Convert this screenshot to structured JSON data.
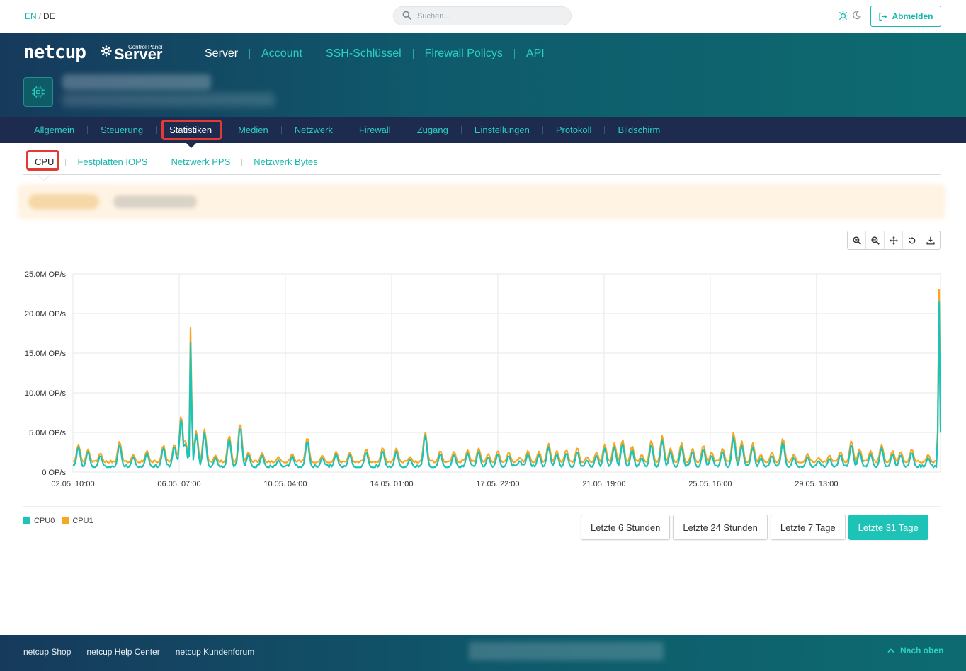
{
  "topbar": {
    "lang_en": "EN",
    "lang_sep": "/",
    "lang_de": "DE",
    "search_placeholder": "Suchen...",
    "logout_label": "Abmelden"
  },
  "header": {
    "brand": "netcup",
    "product": "Server",
    "product_sub": "Control Panel",
    "nav": [
      "Server",
      "Account",
      "SSH-Schlüssel",
      "Firewall Policys",
      "API"
    ]
  },
  "subnav": [
    "Allgemein",
    "Steuerung",
    "Statistiken",
    "Medien",
    "Netzwerk",
    "Firewall",
    "Zugang",
    "Einstellungen",
    "Protokoll",
    "Bildschirm"
  ],
  "tabs": [
    "CPU",
    "Festplatten IOPS",
    "Netzwerk PPS",
    "Netzwerk Bytes"
  ],
  "ranges": [
    "Letzte 6 Stunden",
    "Letzte 24 Stunden",
    "Letzte 7 Tage",
    "Letzte 31 Tage"
  ],
  "footer": {
    "links": [
      "netcup Shop",
      "netcup Help Center",
      "netcup Kundenforum"
    ],
    "to_top": "Nach oben"
  },
  "colors": {
    "accent": "#17b8ad",
    "cpu0": "#1cc3b6",
    "cpu1": "#f5a623",
    "highlight": "#e53935"
  },
  "chart_data": {
    "type": "line",
    "yticks": [
      "25.0M OP/s",
      "20.0M OP/s",
      "15.0M OP/s",
      "10.0M OP/s",
      "5.0M OP/s",
      "0 OP/s"
    ],
    "ylim": [
      0,
      25000000
    ],
    "xticks": [
      "02.05. 10:00",
      "06.05. 07:00",
      "10.05. 04:00",
      "14.05. 01:00",
      "17.05. 22:00",
      "21.05. 19:00",
      "25.05. 16:00",
      "29.05. 13:00"
    ],
    "xlim_days": [
      0,
      31.65
    ],
    "series": [
      {
        "name": "CPU0",
        "color": "#1cc3b6",
        "baseline": 600000,
        "noise": 350000,
        "peaks": [
          [
            0.2,
            3.2
          ],
          [
            0.55,
            2.6
          ],
          [
            1.0,
            2.1
          ],
          [
            1.7,
            3.5
          ],
          [
            2.2,
            1.9
          ],
          [
            2.7,
            2.4
          ],
          [
            3.3,
            3.1
          ],
          [
            3.7,
            3.3
          ],
          [
            3.95,
            6.8
          ],
          [
            4.1,
            3.6
          ],
          [
            4.3,
            17.8
          ],
          [
            4.5,
            4.8
          ],
          [
            4.8,
            5.0
          ],
          [
            5.2,
            1.8
          ],
          [
            5.7,
            4.2
          ],
          [
            6.1,
            5.8
          ],
          [
            6.4,
            2.2
          ],
          [
            6.9,
            2.1
          ],
          [
            7.5,
            1.5
          ],
          [
            8.0,
            2.0
          ],
          [
            8.55,
            4.0
          ],
          [
            9.1,
            1.8
          ],
          [
            9.6,
            2.3
          ],
          [
            10.1,
            2.2
          ],
          [
            10.7,
            2.5
          ],
          [
            11.3,
            2.7
          ],
          [
            11.8,
            2.6
          ],
          [
            12.3,
            1.6
          ],
          [
            12.85,
            4.7
          ],
          [
            13.4,
            2.3
          ],
          [
            13.9,
            2.2
          ],
          [
            14.4,
            2.4
          ],
          [
            14.8,
            2.6
          ],
          [
            15.15,
            1.9
          ],
          [
            15.5,
            2.3
          ],
          [
            15.9,
            2.1
          ],
          [
            16.3,
            1.4
          ],
          [
            16.6,
            2.3
          ],
          [
            17.0,
            2.2
          ],
          [
            17.35,
            3.2
          ],
          [
            17.65,
            2.3
          ],
          [
            18.0,
            2.4
          ],
          [
            18.4,
            2.6
          ],
          [
            18.75,
            1.5
          ],
          [
            19.1,
            2.1
          ],
          [
            19.4,
            3.0
          ],
          [
            19.75,
            3.2
          ],
          [
            20.05,
            3.6
          ],
          [
            20.4,
            2.8
          ],
          [
            20.75,
            1.8
          ],
          [
            21.1,
            3.5
          ],
          [
            21.5,
            4.1
          ],
          [
            21.8,
            2.6
          ],
          [
            22.2,
            3.2
          ],
          [
            22.6,
            2.6
          ],
          [
            23.0,
            2.9
          ],
          [
            23.3,
            2.1
          ],
          [
            23.7,
            2.6
          ],
          [
            24.1,
            4.4
          ],
          [
            24.4,
            3.4
          ],
          [
            24.8,
            3.2
          ],
          [
            25.1,
            1.8
          ],
          [
            25.5,
            2.1
          ],
          [
            25.9,
            3.8
          ],
          [
            26.3,
            1.8
          ],
          [
            26.8,
            1.9
          ],
          [
            27.2,
            1.4
          ],
          [
            27.6,
            1.7
          ],
          [
            28.0,
            2.2
          ],
          [
            28.4,
            3.5
          ],
          [
            28.7,
            2.5
          ],
          [
            29.1,
            2.3
          ],
          [
            29.5,
            3.1
          ],
          [
            29.9,
            2.3
          ],
          [
            30.2,
            2.2
          ],
          [
            30.6,
            2.5
          ],
          [
            31.2,
            1.8
          ],
          [
            31.6,
            21.5
          ]
        ]
      },
      {
        "name": "CPU1",
        "color": "#f5a623",
        "baseline": 1200000,
        "noise": 300000,
        "peaks": [
          [
            0.2,
            3.5
          ],
          [
            0.55,
            2.9
          ],
          [
            1.0,
            2.4
          ],
          [
            1.7,
            3.9
          ],
          [
            2.2,
            2.2
          ],
          [
            2.7,
            2.7
          ],
          [
            3.3,
            3.4
          ],
          [
            3.7,
            3.6
          ],
          [
            3.95,
            7.2
          ],
          [
            4.1,
            4.0
          ],
          [
            4.3,
            19.8
          ],
          [
            4.5,
            5.2
          ],
          [
            4.8,
            5.4
          ],
          [
            5.2,
            2.1
          ],
          [
            5.7,
            4.6
          ],
          [
            6.1,
            6.3
          ],
          [
            6.4,
            2.5
          ],
          [
            6.9,
            2.4
          ],
          [
            7.5,
            1.9
          ],
          [
            8.0,
            2.3
          ],
          [
            8.55,
            4.4
          ],
          [
            9.1,
            2.1
          ],
          [
            9.6,
            2.6
          ],
          [
            10.1,
            2.5
          ],
          [
            10.7,
            2.9
          ],
          [
            11.3,
            3.1
          ],
          [
            11.8,
            3.0
          ],
          [
            12.3,
            1.9
          ],
          [
            12.85,
            5.1
          ],
          [
            13.4,
            2.7
          ],
          [
            13.9,
            2.6
          ],
          [
            14.4,
            2.8
          ],
          [
            14.8,
            3.0
          ],
          [
            15.15,
            2.3
          ],
          [
            15.5,
            2.7
          ],
          [
            15.9,
            2.5
          ],
          [
            16.3,
            1.8
          ],
          [
            16.6,
            2.7
          ],
          [
            17.0,
            2.6
          ],
          [
            17.35,
            3.6
          ],
          [
            17.65,
            2.7
          ],
          [
            18.0,
            2.8
          ],
          [
            18.4,
            3.1
          ],
          [
            18.75,
            1.9
          ],
          [
            19.1,
            2.5
          ],
          [
            19.4,
            3.5
          ],
          [
            19.75,
            3.7
          ],
          [
            20.05,
            4.1
          ],
          [
            20.4,
            3.3
          ],
          [
            20.75,
            2.2
          ],
          [
            21.1,
            4.0
          ],
          [
            21.5,
            4.6
          ],
          [
            21.8,
            3.0
          ],
          [
            22.2,
            3.7
          ],
          [
            22.6,
            3.0
          ],
          [
            23.0,
            3.4
          ],
          [
            23.3,
            2.5
          ],
          [
            23.7,
            3.0
          ],
          [
            24.1,
            5.0
          ],
          [
            24.4,
            3.9
          ],
          [
            24.8,
            3.7
          ],
          [
            25.1,
            2.2
          ],
          [
            25.5,
            2.5
          ],
          [
            25.9,
            4.3
          ],
          [
            26.3,
            2.2
          ],
          [
            26.8,
            2.3
          ],
          [
            27.2,
            1.8
          ],
          [
            27.6,
            2.1
          ],
          [
            28.0,
            2.6
          ],
          [
            28.4,
            4.0
          ],
          [
            28.7,
            2.9
          ],
          [
            29.1,
            2.7
          ],
          [
            29.5,
            3.5
          ],
          [
            29.9,
            2.7
          ],
          [
            30.2,
            2.6
          ],
          [
            30.6,
            2.9
          ],
          [
            31.2,
            2.2
          ],
          [
            31.6,
            23.0
          ]
        ]
      }
    ]
  }
}
